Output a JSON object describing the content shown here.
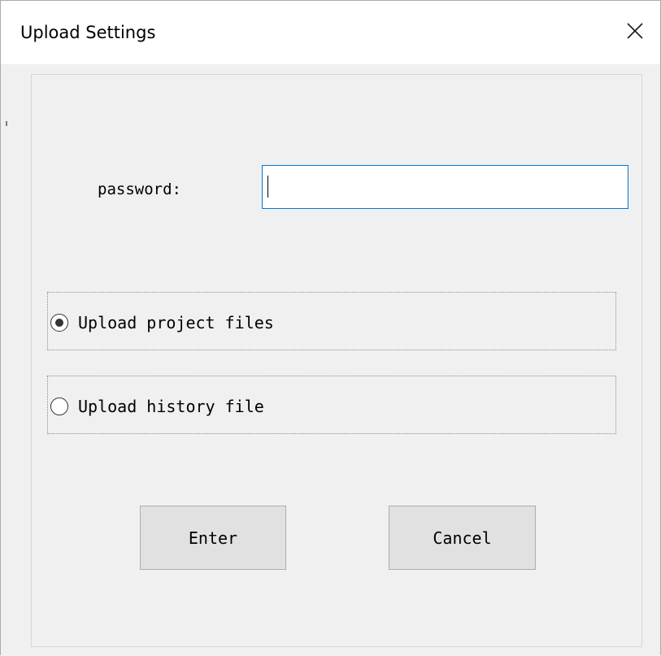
{
  "window": {
    "title": "Upload Settings"
  },
  "form": {
    "password_label": "password:",
    "password_value": "",
    "password_placeholder": ""
  },
  "options": [
    {
      "label": "Upload project files",
      "selected": true
    },
    {
      "label": "Upload history file",
      "selected": false
    }
  ],
  "buttons": {
    "enter_label": "Enter",
    "cancel_label": "Cancel"
  },
  "colors": {
    "accent": "#0078d7",
    "background": "#f0f0f0",
    "button_face": "#e1e1e1"
  },
  "icons": {
    "close": "close-icon"
  }
}
